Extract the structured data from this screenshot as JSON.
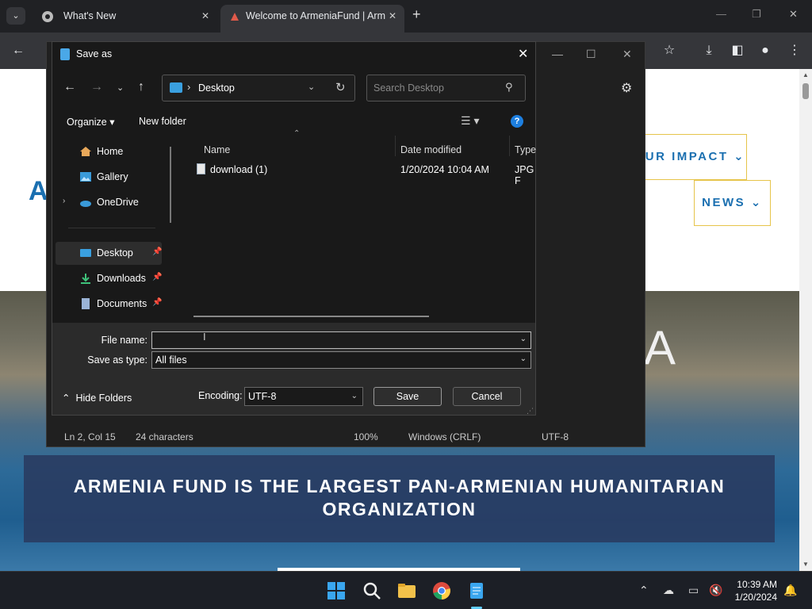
{
  "browser": {
    "tabs": [
      {
        "title": "What's New"
      },
      {
        "title": "Welcome to ArmeniaFund | Arm"
      }
    ]
  },
  "page": {
    "logo_text": "A",
    "nav": {
      "impact": "UR IMPACT ⌄",
      "news": "NEWS ⌄"
    },
    "hero_letter": "A",
    "banner": {
      "line1": "ARMENIA FUND IS THE LARGEST PAN-ARMENIAN HUMANITARIAN",
      "line2": "ORGANIZATION"
    }
  },
  "notepad": {
    "status": {
      "position": "Ln 2, Col 15",
      "chars": "24 characters",
      "zoom": "100%",
      "line_ending": "Windows (CRLF)",
      "encoding": "UTF-8"
    }
  },
  "dialog": {
    "title": "Save as",
    "address": "Desktop",
    "search_placeholder": "Search Desktop",
    "organize": "Organize ▾",
    "new_folder": "New folder",
    "help": "?",
    "nav_items": [
      {
        "label": "Home"
      },
      {
        "label": "Gallery"
      },
      {
        "label": "OneDrive"
      },
      {
        "label": "Desktop"
      },
      {
        "label": "Downloads"
      },
      {
        "label": "Documents"
      }
    ],
    "columns": {
      "name": "Name",
      "date": "Date modified",
      "type": "Type"
    },
    "files": [
      {
        "name": "download (1)",
        "date": "1/20/2024 10:04 AM",
        "type": "JPG F"
      }
    ],
    "file_name_label": "File name:",
    "file_name_value": "",
    "save_type_label": "Save as type:",
    "save_type_value": "All files",
    "hide_folders": "Hide Folders",
    "encoding_label": "Encoding:",
    "encoding_value": "UTF-8",
    "save_btn": "Save",
    "cancel_btn": "Cancel"
  },
  "taskbar": {
    "time": "10:39 AM",
    "date": "1/20/2024"
  },
  "colors": {
    "accent": "#1d7fe0",
    "site_blue": "#1a6fb0",
    "site_gold": "#e6c44a"
  }
}
